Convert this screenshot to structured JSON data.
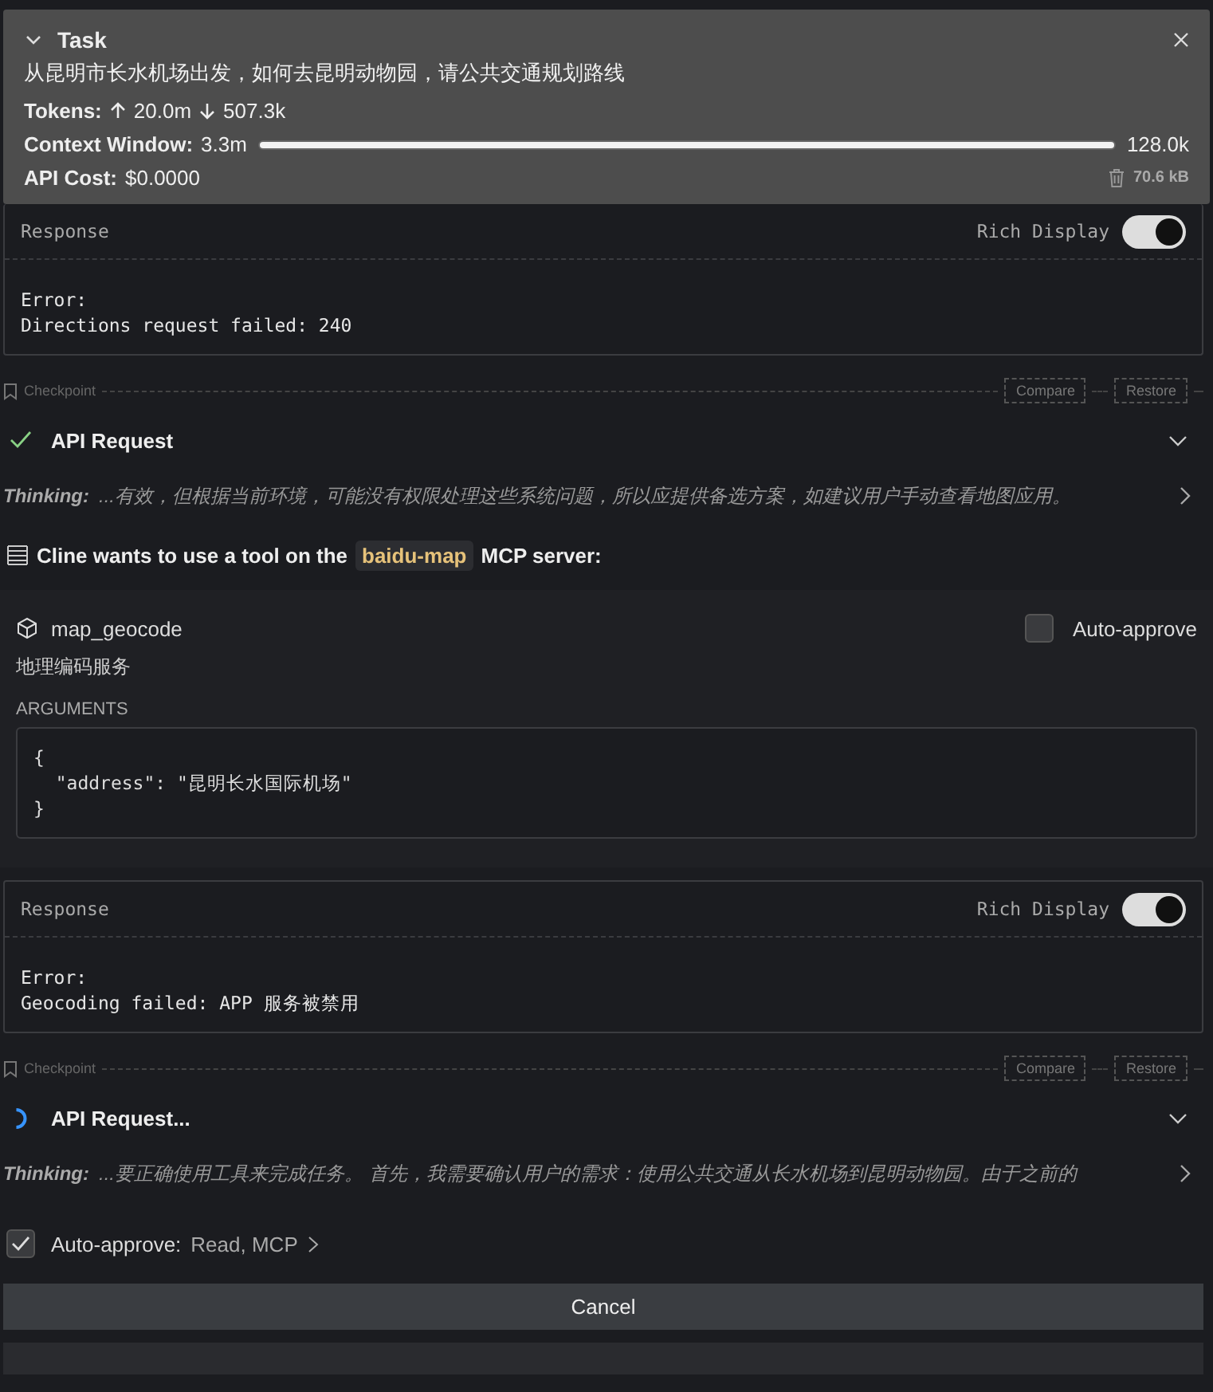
{
  "task": {
    "title": "Task",
    "expanded": true,
    "text": "从昆明市长水机场出发，如何去昆明动物园，请公共交通规划路线",
    "tokens_label": "Tokens:",
    "tokens_up": "20.0m",
    "tokens_down": "507.3k",
    "context_label": "Context Window:",
    "context_used": "3.3m",
    "level": 1,
    "context_max": "128.0k",
    "cost_label": "API Cost:",
    "cost": "$0.0000",
    "size": "70.6 kB"
  },
  "messages": [
    {
      "kind": "response",
      "title": "Response",
      "toggle_label": "Rich Display",
      "rich_display": true,
      "lines": [
        "Error:",
        "Directions request failed: 240"
      ]
    },
    {
      "kind": "checkpoint",
      "label": "Checkpoint",
      "buttons": [
        "Compare",
        "Restore"
      ]
    },
    {
      "kind": "api_request",
      "completed": true,
      "title": "API Request"
    },
    {
      "kind": "thinking",
      "label": "Thinking:",
      "text": "...有效，但根据当前环境，可能没有权限处理这些系统问题，所以应提供备选方案，如建议用户手动查看地图应用。"
    },
    {
      "kind": "mcp_tool",
      "prefix": "Cline wants to use a tool on the",
      "server": "baidu-map",
      "suffix": "MCP server:",
      "tool": "map_geocode",
      "auto_approve_label": "Auto-approve",
      "auto_approve": false,
      "description": "地理编码服务",
      "args_label": "ARGUMENTS",
      "args_lines": [
        "{",
        "  \"address\": \"昆明长水国际机场\"",
        "}"
      ]
    },
    {
      "kind": "response",
      "title": "Response",
      "toggle_label": "Rich Display",
      "rich_display": true,
      "lines": [
        "Error:",
        "Geocoding failed: APP 服务被禁用"
      ]
    },
    {
      "kind": "checkpoint",
      "label": "Checkpoint",
      "buttons": [
        "Compare",
        "Restore"
      ]
    },
    {
      "kind": "api_request",
      "completed": false,
      "title": "API Request..."
    },
    {
      "kind": "thinking",
      "label": "Thinking:",
      "text": "...要正确使用工具来完成任务。 首先，我需要确认用户的需求：使用公共交通从长水机场到昆明动物园。由于之前的"
    }
  ],
  "footer": {
    "auto_approve": {
      "checked": true,
      "label": "Auto-approve:",
      "value": "Read, MCP"
    },
    "cancel": "Cancel"
  }
}
